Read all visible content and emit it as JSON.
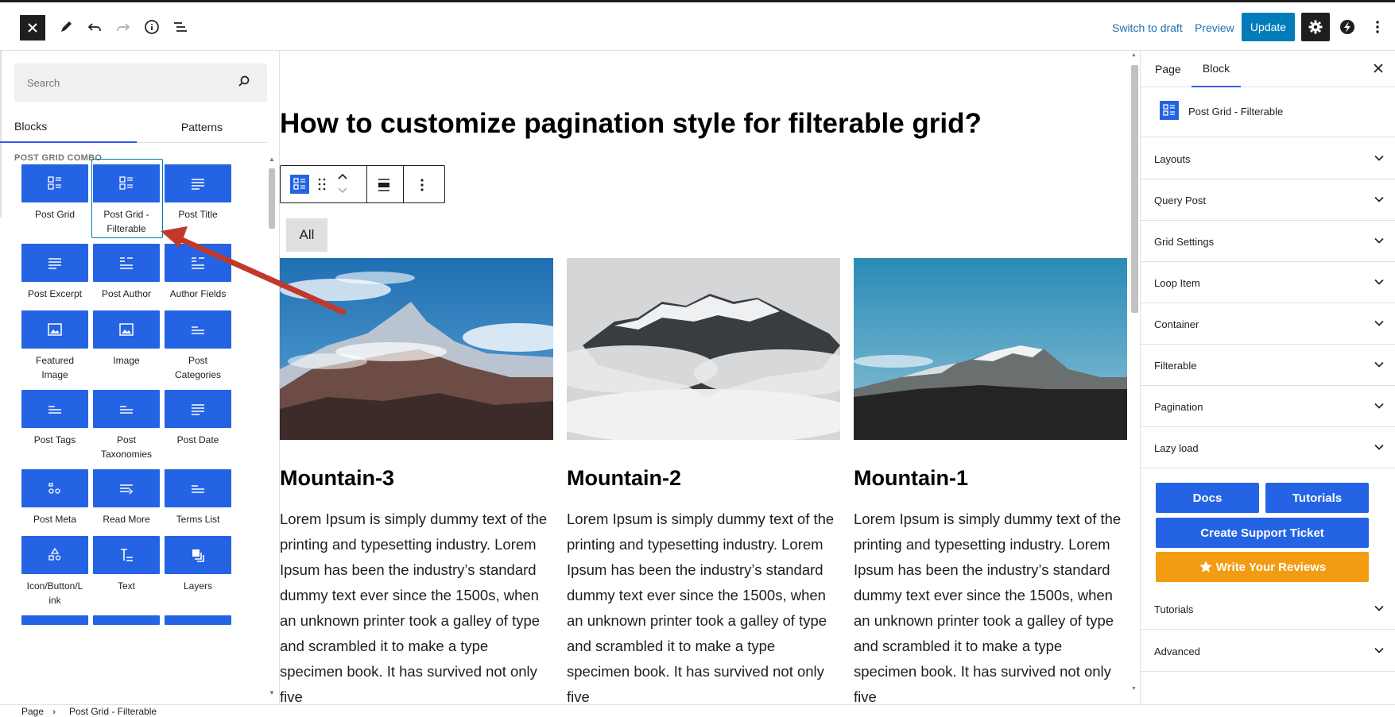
{
  "topbar": {
    "switch_to_draft": "Switch to draft",
    "preview": "Preview",
    "update": "Update"
  },
  "inserter": {
    "search_placeholder": "Search",
    "tabs": [
      "Blocks",
      "Patterns"
    ],
    "category": "POST GRID COMBO",
    "blocks": [
      "Post Grid",
      "Post Grid - Filterable",
      "Post Title",
      "Post Excerpt",
      "Post Author",
      "Author Fields",
      "Featured Image",
      "Image",
      "Post Categories",
      "Post Tags",
      "Post Taxonomies",
      "Post Date",
      "Post Meta",
      "Read More",
      "Terms List",
      "Icon/Button/Link",
      "Text",
      "Layers"
    ],
    "selected_block": "Post Grid - Filterable"
  },
  "canvas": {
    "title": "How to customize pagination style for filterable grid?",
    "filter_all": "All",
    "cards": [
      {
        "title": "Mountain-3",
        "text": "Lorem Ipsum is simply dummy text of the printing and typesetting industry. Lorem Ipsum has been the industry’s standard dummy text ever since the 1500s, when an unknown printer took a galley of type and scrambled it to make a type specimen book. It has survived not only five"
      },
      {
        "title": "Mountain-2",
        "text": "Lorem Ipsum is simply dummy text of the printing and typesetting industry. Lorem Ipsum has been the industry’s standard dummy text ever since the 1500s, when an unknown printer took a galley of type and scrambled it to make a type specimen book. It has survived not only five"
      },
      {
        "title": "Mountain-1",
        "text": "Lorem Ipsum is simply dummy text of the printing and typesetting industry. Lorem Ipsum has been the industry’s standard dummy text ever since the 1500s, when an unknown printer took a galley of type and scrambled it to make a type specimen book. It has survived not only five"
      }
    ]
  },
  "sidebar": {
    "tabs": [
      "Page",
      "Block"
    ],
    "block_name": "Post Grid - Filterable",
    "panels": [
      "Layouts",
      "Query Post",
      "Grid Settings",
      "Loop Item",
      "Container",
      "Filterable",
      "Pagination",
      "Lazy load"
    ],
    "docs": "Docs",
    "tutorials_btn": "Tutorials",
    "support": "Create Support Ticket",
    "reviews": "Write Your Reviews",
    "lower_panels": [
      "Tutorials",
      "Advanced"
    ]
  },
  "footer": {
    "crumb_root": "Page",
    "crumb_current": "Post Grid - Filterable"
  },
  "colors": {
    "accent": "#007cba",
    "block_icon": "#2563e5",
    "review": "#f39c12",
    "annotation_arrow": "#c0392b"
  }
}
